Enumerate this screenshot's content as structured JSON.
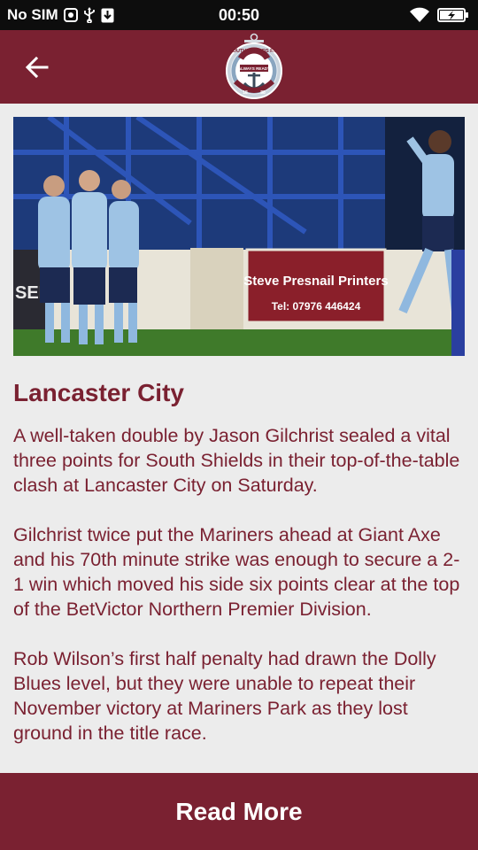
{
  "status_bar": {
    "carrier": "No SIM",
    "time": "00:50",
    "icons": [
      "sim-status-icon",
      "usb-icon",
      "download-icon",
      "wifi-icon",
      "battery-charging-icon"
    ]
  },
  "app_bar": {
    "back_icon": "arrow-back-icon",
    "logo": {
      "top_text": "SOUTH SHIELDS F.C.",
      "banner_text": "ALWAYS READY",
      "year_left": "18",
      "year_right": "88"
    }
  },
  "article": {
    "title": "Lancaster City",
    "paragraphs": [
      "A well-taken double by Jason Gilchrist sealed a vital three points for South Shields in their top-of-the-table clash at Lancaster City on Saturday.",
      "Gilchrist twice put the Mariners ahead at Giant Axe and his 70th minute strike was enough to secure a 2-1 win which moved his side six points clear at the top of the BetVictor Northern Premier Division.",
      "Rob Wilson’s first half penalty had drawn the Dolly Blues level, but they were unable to repeat their November victory at Mariners Park as they lost ground in the title race."
    ],
    "photo": {
      "sign_line1": "Steve Presnail Printers",
      "sign_line2": "Tel: 07976 446424",
      "side_sign": "SENC"
    }
  },
  "footer": {
    "read_more_label": "Read More"
  },
  "colors": {
    "brand": "#7a2131",
    "background": "#ececec",
    "status_bar": "#0d0d0d"
  }
}
